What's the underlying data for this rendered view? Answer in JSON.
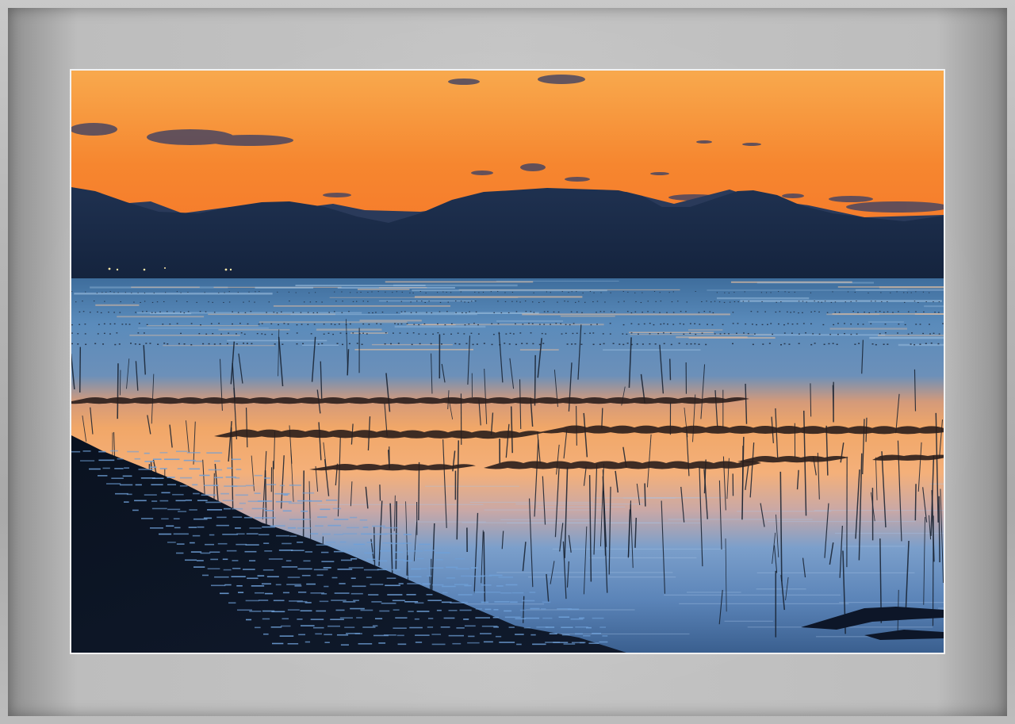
{
  "scene": "sunset-over-seaweed-farm",
  "colors": {
    "mat": "#c4c4c4",
    "sky_top": "#f7a348",
    "sky_mid": "#f57d2a",
    "sky_horizon": "#f68a3c",
    "mountains": "#1b2c48",
    "water_far": "#4d7fb0",
    "water_glow": "#f0a060",
    "stake_dark": "#0c1424"
  }
}
